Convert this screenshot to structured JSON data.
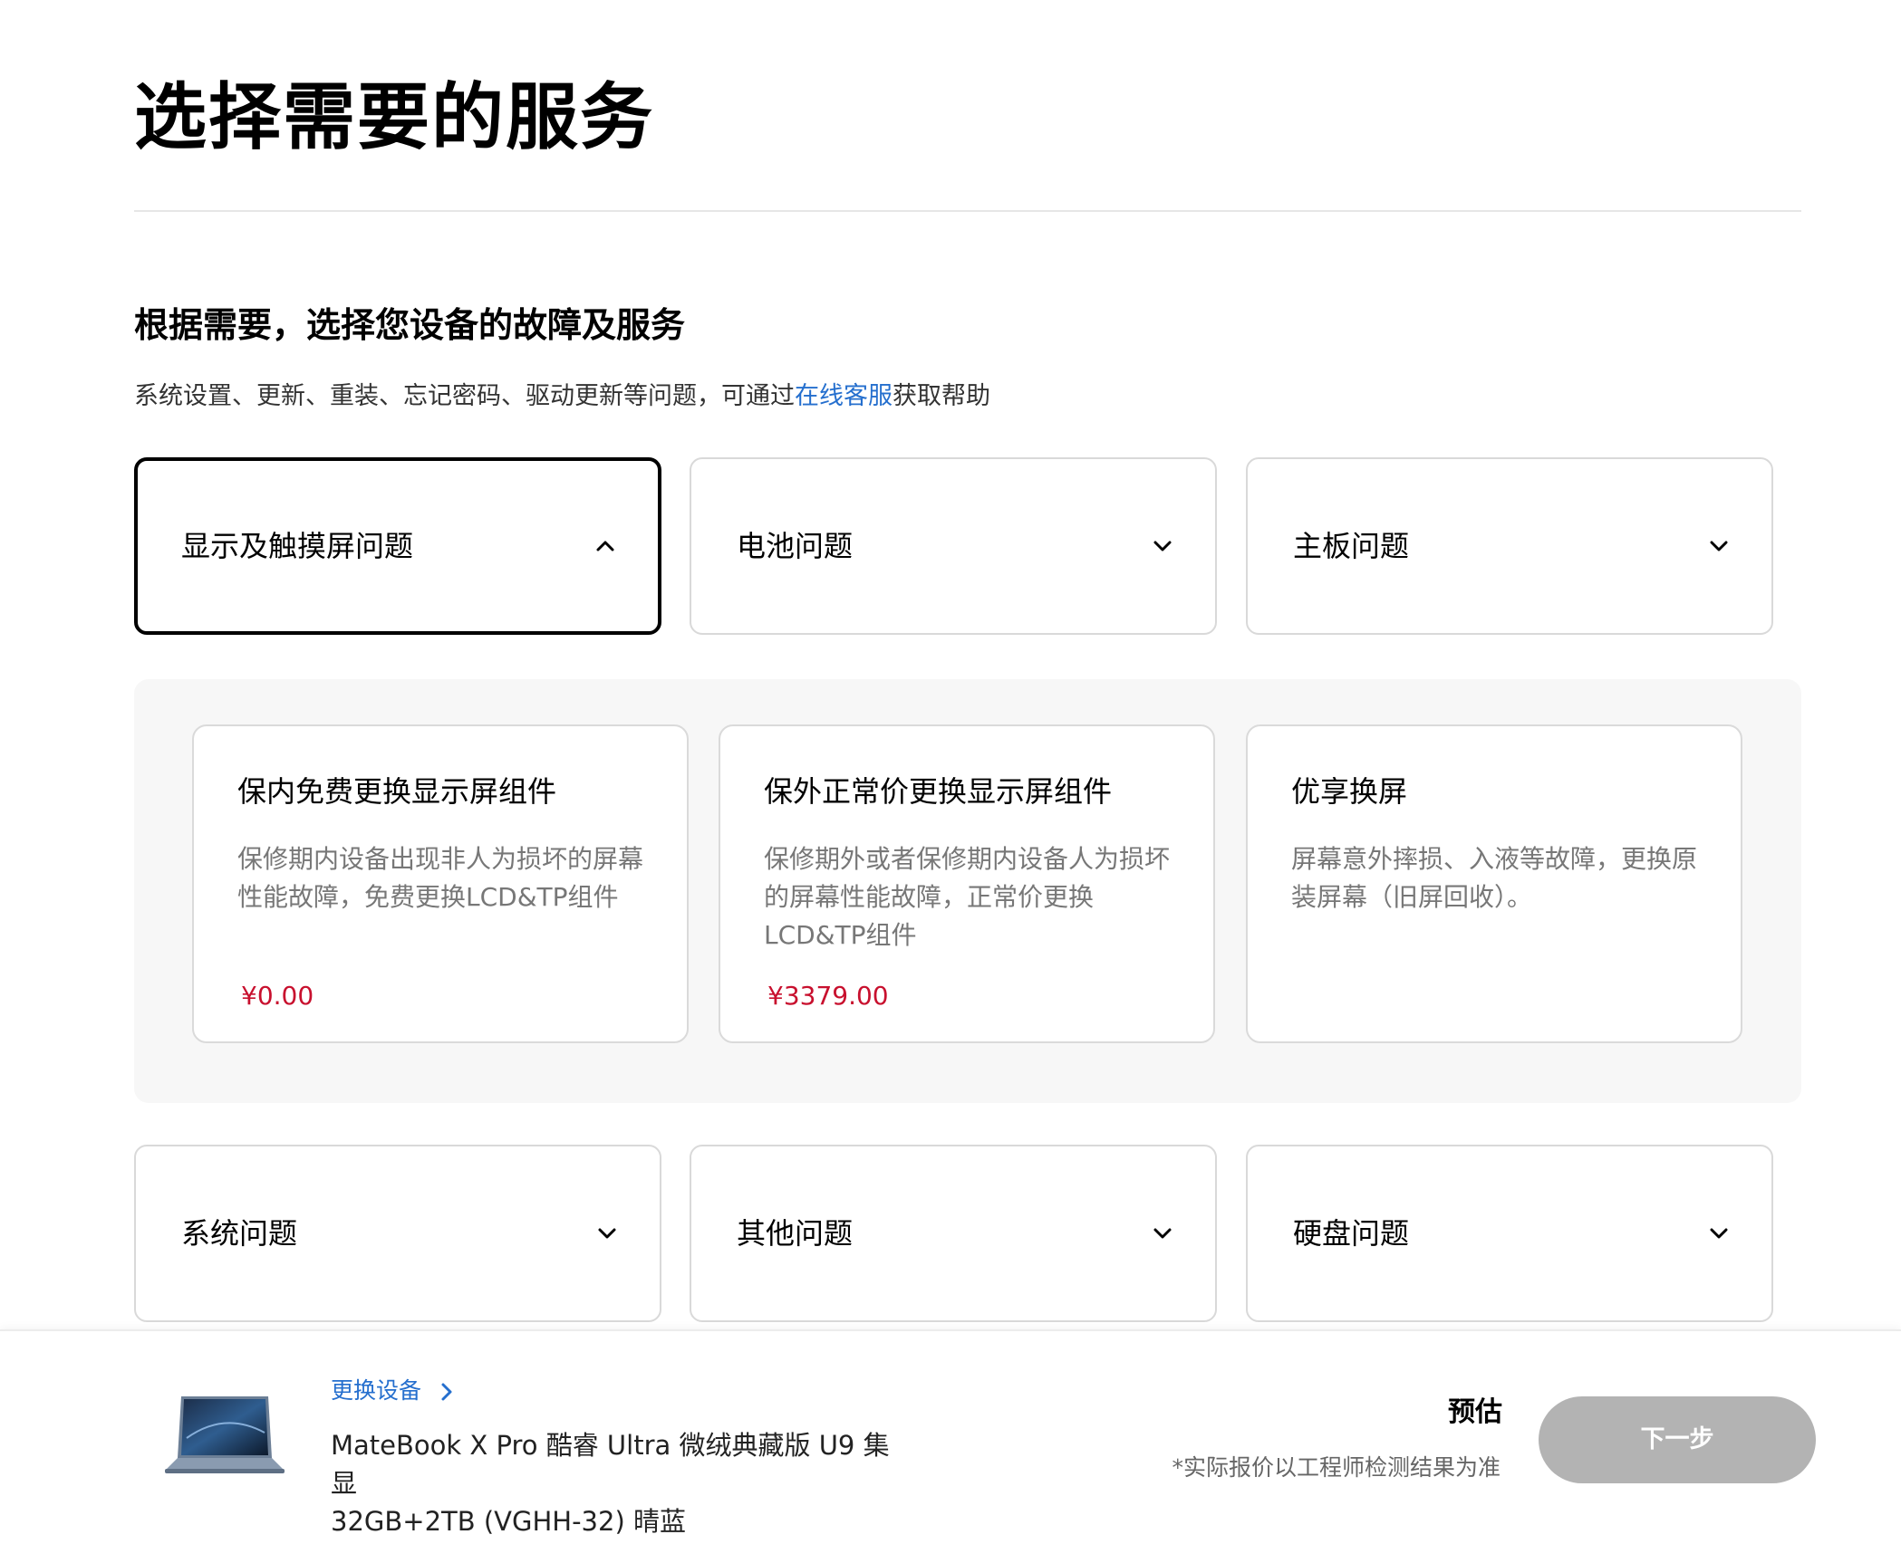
{
  "page": {
    "title": "选择需要的服务"
  },
  "section": {
    "title": "根据需要，选择您设备的故障及服务",
    "desc_before": "系统设置、更新、重装、忘记密码、驱动更新等问题，可通过",
    "desc_link": "在线客服",
    "desc_after": "获取帮助"
  },
  "categories": [
    {
      "label": "显示及触摸屏问题",
      "state": "expanded",
      "icon": "chevron-up-icon"
    },
    {
      "label": "电池问题",
      "state": "collapsed",
      "icon": "chevron-down-icon"
    },
    {
      "label": "主板问题",
      "state": "collapsed",
      "icon": "chevron-down-icon"
    },
    {
      "label": "系统问题",
      "state": "collapsed",
      "icon": "chevron-down-icon"
    },
    {
      "label": "其他问题",
      "state": "collapsed",
      "icon": "chevron-down-icon"
    },
    {
      "label": "硬盘问题",
      "state": "collapsed",
      "icon": "chevron-down-icon"
    }
  ],
  "services": [
    {
      "title": "保内免费更换显示屏组件",
      "desc": "保修期内设备出现非人为损坏的屏幕性能故障，免费更换LCD&TP组件",
      "price": "¥0.00"
    },
    {
      "title": "保外正常价更换显示屏组件",
      "desc": "保修期外或者保修期内设备人为损坏的屏幕性能故障，正常价更换LCD&TP组件",
      "price": "¥3379.00"
    },
    {
      "title": "优享换屏",
      "desc": "屏幕意外摔损、入液等故障，更换原装屏幕（旧屏回收）。",
      "price": ""
    }
  ],
  "bottom_bar": {
    "change_device_label": "更换设备",
    "device_name_line1": "MateBook X Pro 酷睿 Ultra 微绒典藏版 U9 集显",
    "device_name_line2": "32GB+2TB (VGHH-32) 晴蓝",
    "estimate_label": "预估",
    "estimate_note": "*实际报价以工程师检测结果为准",
    "next_button_label": "下一步"
  },
  "colors": {
    "link": "#256fce",
    "price": "#c8102e",
    "button_disabled": "#b3b3b3",
    "panel_bg": "#f7f7f7"
  }
}
